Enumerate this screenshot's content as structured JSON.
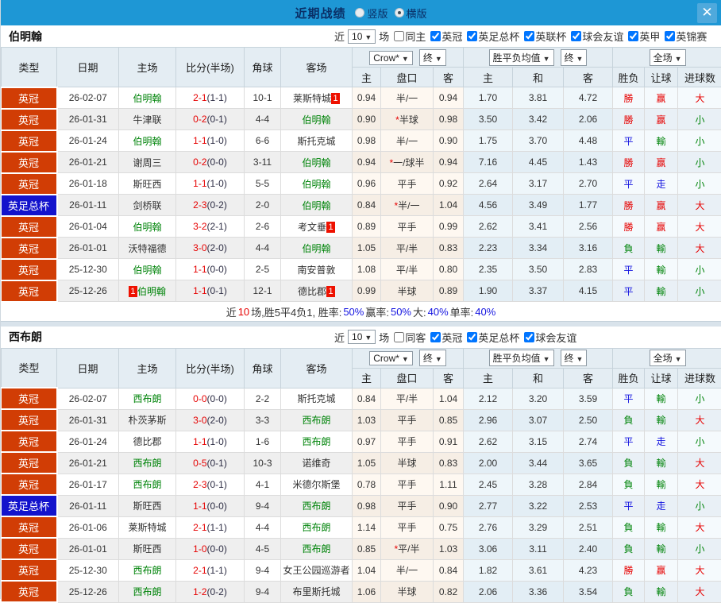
{
  "topbar": {
    "title": "近期战绩",
    "radio_vertical": "竖版",
    "radio_horizontal": "横版",
    "selected_mode": "横版",
    "close_label": "✕"
  },
  "colors": {
    "topbar_bg": "#1e97d5",
    "league_red": "#d13d05",
    "cup_blue": "#1313cc",
    "win_red": "#e60000",
    "draw_blue": "#1414e0",
    "loss_green": "#00840a"
  },
  "header": {
    "fixed_cols": [
      "类型",
      "日期",
      "主场",
      "比分(半场)",
      "角球",
      "客场"
    ],
    "group1_select": "Crow*",
    "group1_final_select": "终",
    "group1_cols": [
      "主",
      "盘口",
      "客"
    ],
    "group2_select": "胜平负均值",
    "group2_final_select": "终",
    "group2_cols": [
      "主",
      "和",
      "客"
    ],
    "group3_select": "全场",
    "group3_cols": [
      "胜负",
      "让球",
      "进球数"
    ]
  },
  "sections": [
    {
      "team": "伯明翰",
      "filter": {
        "near_label": "近",
        "count": "10",
        "games_label": "场",
        "same_label": "同主",
        "same_checked": false,
        "leagues": [
          "英冠",
          "英足总杯",
          "英联杯",
          "球会友谊",
          "英甲",
          "英锦赛"
        ]
      },
      "rows": [
        {
          "t": "英冠",
          "tc": "r",
          "d": "26-02-07",
          "h": "伯明翰",
          "hg": true,
          "hb": "",
          "hbb": false,
          "s": "2-1",
          "sh": "(1-1)",
          "cn": "10-1",
          "a": "莱斯特城",
          "ag": false,
          "ab": "1",
          "o1": "0.94",
          "hc": "半/一",
          "o2": "0.94",
          "e1": "1.70",
          "e2": "3.81",
          "e3": "4.72",
          "r1": "勝",
          "r2": "赢",
          "r3": "大"
        },
        {
          "t": "英冠",
          "tc": "r",
          "d": "26-01-31",
          "h": "牛津联",
          "hg": false,
          "hb": "",
          "hbb": false,
          "s": "0-2",
          "sh": "(0-1)",
          "cn": "4-4",
          "a": "伯明翰",
          "ag": true,
          "ab": "",
          "o1": "0.90",
          "hc": "*半球",
          "o2": "0.98",
          "e1": "3.50",
          "e2": "3.42",
          "e3": "2.06",
          "r1": "勝",
          "r2": "赢",
          "r3": "小"
        },
        {
          "t": "英冠",
          "tc": "r",
          "d": "26-01-24",
          "h": "伯明翰",
          "hg": true,
          "hb": "",
          "hbb": false,
          "s": "1-1",
          "sh": "(1-0)",
          "cn": "6-6",
          "a": "斯托克城",
          "ag": false,
          "ab": "",
          "o1": "0.98",
          "hc": "半/一",
          "o2": "0.90",
          "e1": "1.75",
          "e2": "3.70",
          "e3": "4.48",
          "r1": "平",
          "r2": "輸",
          "r3": "小"
        },
        {
          "t": "英冠",
          "tc": "r",
          "d": "26-01-21",
          "h": "谢周三",
          "hg": false,
          "hb": "",
          "hbb": false,
          "s": "0-2",
          "sh": "(0-0)",
          "cn": "3-11",
          "a": "伯明翰",
          "ag": true,
          "ab": "",
          "o1": "0.94",
          "hc": "*一/球半",
          "o2": "0.94",
          "e1": "7.16",
          "e2": "4.45",
          "e3": "1.43",
          "r1": "勝",
          "r2": "赢",
          "r3": "小"
        },
        {
          "t": "英冠",
          "tc": "r",
          "d": "26-01-18",
          "h": "斯旺西",
          "hg": false,
          "hb": "",
          "hbb": false,
          "s": "1-1",
          "sh": "(1-0)",
          "cn": "5-5",
          "a": "伯明翰",
          "ag": true,
          "ab": "",
          "o1": "0.96",
          "hc": "平手",
          "o2": "0.92",
          "e1": "2.64",
          "e2": "3.17",
          "e3": "2.70",
          "r1": "平",
          "r2": "走",
          "r3": "小"
        },
        {
          "t": "英足总杯",
          "tc": "b",
          "d": "26-01-11",
          "h": "剑桥联",
          "hg": false,
          "hb": "",
          "hbb": false,
          "s": "2-3",
          "sh": "(0-2)",
          "cn": "2-0",
          "a": "伯明翰",
          "ag": true,
          "ab": "",
          "o1": "0.84",
          "hc": "*半/一",
          "o2": "1.04",
          "e1": "4.56",
          "e2": "3.49",
          "e3": "1.77",
          "r1": "勝",
          "r2": "赢",
          "r3": "大"
        },
        {
          "t": "英冠",
          "tc": "r",
          "d": "26-01-04",
          "h": "伯明翰",
          "hg": true,
          "hb": "",
          "hbb": false,
          "s": "3-2",
          "sh": "(2-1)",
          "cn": "2-6",
          "a": "考文垂",
          "ag": false,
          "ab": "1",
          "o1": "0.89",
          "hc": "平手",
          "o2": "0.99",
          "e1": "2.62",
          "e2": "3.41",
          "e3": "2.56",
          "r1": "勝",
          "r2": "赢",
          "r3": "大"
        },
        {
          "t": "英冠",
          "tc": "r",
          "d": "26-01-01",
          "h": "沃特福德",
          "hg": false,
          "hb": "",
          "hbb": false,
          "s": "3-0",
          "sh": "(2-0)",
          "cn": "4-4",
          "a": "伯明翰",
          "ag": true,
          "ab": "",
          "o1": "1.05",
          "hc": "平/半",
          "o2": "0.83",
          "e1": "2.23",
          "e2": "3.34",
          "e3": "3.16",
          "r1": "負",
          "r2": "輸",
          "r3": "大"
        },
        {
          "t": "英冠",
          "tc": "r",
          "d": "25-12-30",
          "h": "伯明翰",
          "hg": true,
          "hb": "",
          "hbb": false,
          "s": "1-1",
          "sh": "(0-0)",
          "cn": "2-5",
          "a": "南安普敦",
          "ag": false,
          "ab": "",
          "o1": "1.08",
          "hc": "平/半",
          "o2": "0.80",
          "e1": "2.35",
          "e2": "3.50",
          "e3": "2.83",
          "r1": "平",
          "r2": "輸",
          "r3": "小"
        },
        {
          "t": "英冠",
          "tc": "r",
          "d": "25-12-26",
          "h": "伯明翰",
          "hg": true,
          "hb": "1",
          "hbb": true,
          "s": "1-1",
          "sh": "(0-1)",
          "cn": "12-1",
          "a": "德比郡",
          "ag": false,
          "ab": "1",
          "o1": "0.99",
          "hc": "半球",
          "o2": "0.89",
          "e1": "1.90",
          "e2": "3.37",
          "e3": "4.15",
          "r1": "平",
          "r2": "輸",
          "r3": "小"
        }
      ],
      "summary_parts": [
        {
          "t": "近",
          "c": "k"
        },
        {
          "t": "10",
          "c": "r"
        },
        {
          "t": "场,胜5平4负1, 胜率:",
          "c": "k"
        },
        {
          "t": "50%",
          "c": "b"
        },
        {
          "t": " 赢率:",
          "c": "k"
        },
        {
          "t": "50%",
          "c": "b"
        },
        {
          "t": " 大:",
          "c": "k"
        },
        {
          "t": "40%",
          "c": "b"
        },
        {
          "t": " 单率:",
          "c": "k"
        },
        {
          "t": "40%",
          "c": "b"
        }
      ]
    },
    {
      "team": "西布朗",
      "filter": {
        "near_label": "近",
        "count": "10",
        "games_label": "场",
        "same_label": "同客",
        "same_checked": false,
        "leagues": [
          "英冠",
          "英足总杯",
          "球会友谊"
        ]
      },
      "rows": [
        {
          "t": "英冠",
          "tc": "r",
          "d": "26-02-07",
          "h": "西布朗",
          "hg": true,
          "hb": "",
          "hbb": false,
          "s": "0-0",
          "sh": "(0-0)",
          "cn": "2-2",
          "a": "斯托克城",
          "ag": false,
          "ab": "",
          "o1": "0.84",
          "hc": "平/半",
          "o2": "1.04",
          "e1": "2.12",
          "e2": "3.20",
          "e3": "3.59",
          "r1": "平",
          "r2": "輸",
          "r3": "小"
        },
        {
          "t": "英冠",
          "tc": "r",
          "d": "26-01-31",
          "h": "朴茨茅斯",
          "hg": false,
          "hb": "",
          "hbb": false,
          "s": "3-0",
          "sh": "(2-0)",
          "cn": "3-3",
          "a": "西布朗",
          "ag": true,
          "ab": "",
          "o1": "1.03",
          "hc": "平手",
          "o2": "0.85",
          "e1": "2.96",
          "e2": "3.07",
          "e3": "2.50",
          "r1": "負",
          "r2": "輸",
          "r3": "大"
        },
        {
          "t": "英冠",
          "tc": "r",
          "d": "26-01-24",
          "h": "德比郡",
          "hg": false,
          "hb": "",
          "hbb": false,
          "s": "1-1",
          "sh": "(1-0)",
          "cn": "1-6",
          "a": "西布朗",
          "ag": true,
          "ab": "",
          "o1": "0.97",
          "hc": "平手",
          "o2": "0.91",
          "e1": "2.62",
          "e2": "3.15",
          "e3": "2.74",
          "r1": "平",
          "r2": "走",
          "r3": "小"
        },
        {
          "t": "英冠",
          "tc": "r",
          "d": "26-01-21",
          "h": "西布朗",
          "hg": true,
          "hb": "",
          "hbb": false,
          "s": "0-5",
          "sh": "(0-1)",
          "cn": "10-3",
          "a": "诺维奇",
          "ag": false,
          "ab": "",
          "o1": "1.05",
          "hc": "半球",
          "o2": "0.83",
          "e1": "2.00",
          "e2": "3.44",
          "e3": "3.65",
          "r1": "負",
          "r2": "輸",
          "r3": "大"
        },
        {
          "t": "英冠",
          "tc": "r",
          "d": "26-01-17",
          "h": "西布朗",
          "hg": true,
          "hb": "",
          "hbb": false,
          "s": "2-3",
          "sh": "(0-1)",
          "cn": "4-1",
          "a": "米德尔斯堡",
          "ag": false,
          "ab": "",
          "o1": "0.78",
          "hc": "平手",
          "o2": "1.11",
          "e1": "2.45",
          "e2": "3.28",
          "e3": "2.84",
          "r1": "負",
          "r2": "輸",
          "r3": "大"
        },
        {
          "t": "英足总杯",
          "tc": "b",
          "d": "26-01-11",
          "h": "斯旺西",
          "hg": false,
          "hb": "",
          "hbb": false,
          "s": "1-1",
          "sh": "(0-0)",
          "cn": "9-4",
          "a": "西布朗",
          "ag": true,
          "ab": "",
          "o1": "0.98",
          "hc": "平手",
          "o2": "0.90",
          "e1": "2.77",
          "e2": "3.22",
          "e3": "2.53",
          "r1": "平",
          "r2": "走",
          "r3": "小"
        },
        {
          "t": "英冠",
          "tc": "r",
          "d": "26-01-06",
          "h": "莱斯特城",
          "hg": false,
          "hb": "",
          "hbb": false,
          "s": "2-1",
          "sh": "(1-1)",
          "cn": "4-4",
          "a": "西布朗",
          "ag": true,
          "ab": "",
          "o1": "1.14",
          "hc": "平手",
          "o2": "0.75",
          "e1": "2.76",
          "e2": "3.29",
          "e3": "2.51",
          "r1": "負",
          "r2": "輸",
          "r3": "大"
        },
        {
          "t": "英冠",
          "tc": "r",
          "d": "26-01-01",
          "h": "斯旺西",
          "hg": false,
          "hb": "",
          "hbb": false,
          "s": "1-0",
          "sh": "(0-0)",
          "cn": "4-5",
          "a": "西布朗",
          "ag": true,
          "ab": "",
          "o1": "0.85",
          "hc": "*平/半",
          "o2": "1.03",
          "e1": "3.06",
          "e2": "3.11",
          "e3": "2.40",
          "r1": "負",
          "r2": "輸",
          "r3": "小"
        },
        {
          "t": "英冠",
          "tc": "r",
          "d": "25-12-30",
          "h": "西布朗",
          "hg": true,
          "hb": "",
          "hbb": false,
          "s": "2-1",
          "sh": "(1-1)",
          "cn": "9-4",
          "a": "女王公园巡游者",
          "ag": false,
          "ab": "",
          "o1": "1.04",
          "hc": "半/一",
          "o2": "0.84",
          "e1": "1.82",
          "e2": "3.61",
          "e3": "4.23",
          "r1": "勝",
          "r2": "赢",
          "r3": "大"
        },
        {
          "t": "英冠",
          "tc": "r",
          "d": "25-12-26",
          "h": "西布朗",
          "hg": true,
          "hb": "",
          "hbb": false,
          "s": "1-2",
          "sh": "(0-2)",
          "cn": "9-4",
          "a": "布里斯托城",
          "ag": false,
          "ab": "",
          "o1": "1.06",
          "hc": "半球",
          "o2": "0.82",
          "e1": "2.06",
          "e2": "3.36",
          "e3": "3.54",
          "r1": "負",
          "r2": "輸",
          "r3": "大"
        }
      ],
      "summary_parts": []
    }
  ]
}
